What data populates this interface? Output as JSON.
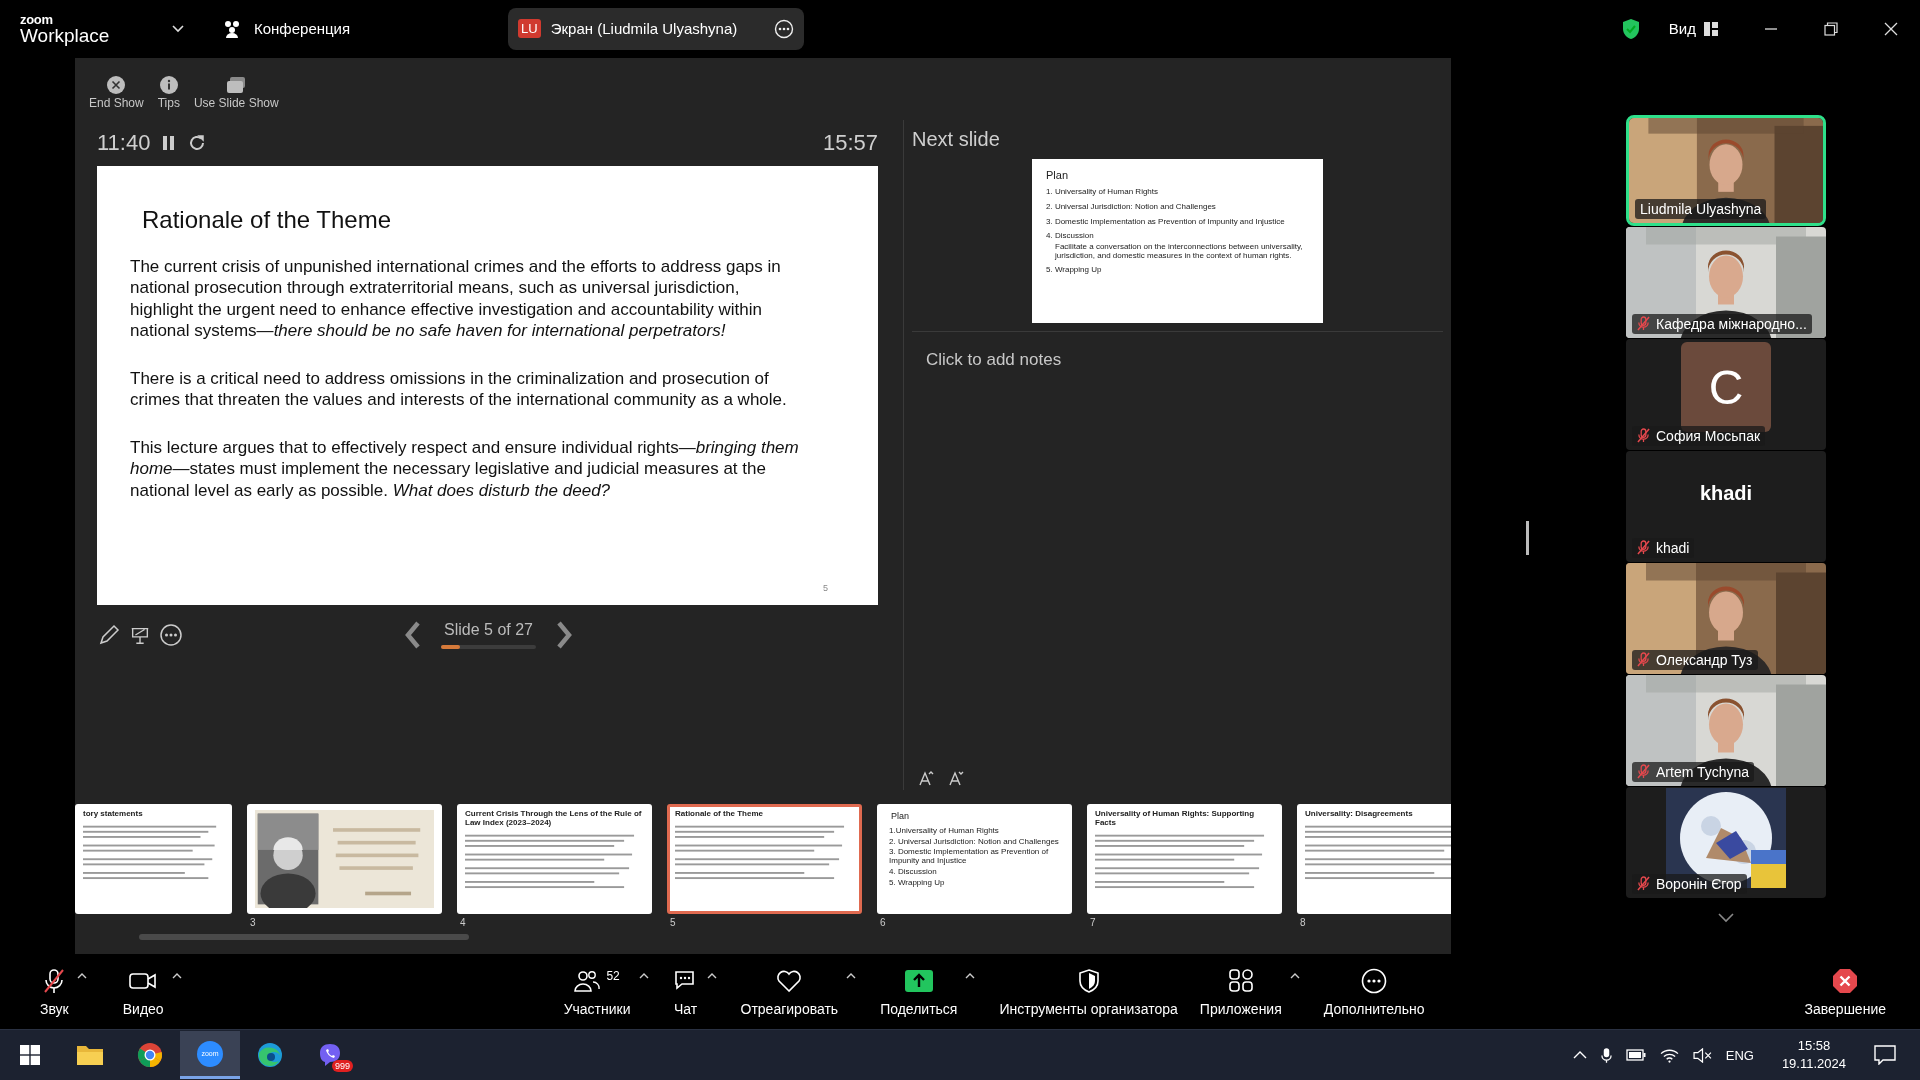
{
  "title_bar": {
    "logo_top": "zoom",
    "logo_bottom": "Workplace",
    "meeting": "Конференция",
    "share_badge": "LU",
    "share_label": "Экран (Liudmila Ulyashyna)",
    "view": "Вид"
  },
  "presenter": {
    "toolbar": [
      {
        "label": "End Show",
        "kind": "end"
      },
      {
        "label": "Tips",
        "kind": "tips"
      },
      {
        "label": "Use Slide Show",
        "kind": "slideshow"
      }
    ],
    "elapsed": "11:40",
    "clock": "15:57",
    "slide": {
      "title": "Rationale of the Theme",
      "paragraphs": [
        "The current crisis of unpunished international crimes and the efforts to address gaps in national prosecution through extraterritorial means, such as universal jurisdiction, highlight the urgent need to enhance effective investigation and accountability within national systems—*there should be no safe haven for international perpetrators!*",
        "There is a critical need to address omissions in the criminalization and prosecution of crimes that threaten the values and interests of the international community as a whole.",
        "This lecture argues that to effectively respect and ensure individual rights—*bringing them home*—states must implement the necessary legislative and judicial measures at the national level as early as possible. *What does disturb the deed?*"
      ],
      "page_number": "5"
    },
    "counter": "Slide 5 of 27",
    "progress": {
      "level": 0.2
    },
    "next_label": "Next slide",
    "next_slide": {
      "title": "Plan",
      "items": [
        {
          "text": "1. Universality of Human Rights"
        },
        {
          "text": "2. Universal Jurisdiction: Notion and Challenges"
        },
        {
          "text": "3. Domestic Implementation as Prevention of Impunity and Injustice"
        },
        {
          "text": "4. Discussion",
          "note": "Facilitate a conversation on the interconnections between universality, jurisdiction, and domestic measures in the context of human rights."
        },
        {
          "text": "5. Wrapping Up"
        }
      ]
    },
    "notes_placeholder": "Click to add notes"
  },
  "thumbnails": [
    {
      "kind": "text",
      "title": "tory statements",
      "partial": true,
      "selected": false
    },
    {
      "kind": "picture",
      "number": "3",
      "selected": false
    },
    {
      "kind": "text",
      "number": "4",
      "title": "Current Crisis Through the Lens of the Rule of Law Index (2023–2024)",
      "selected": false
    },
    {
      "kind": "text",
      "number": "5",
      "title": "Rationale of the Theme",
      "selected": true
    },
    {
      "kind": "plan",
      "number": "6",
      "title": "Plan",
      "items": [
        "1.Universality of Human Rights",
        "2. Universal Jurisdiction: Notion and Challenges",
        "3. Domestic Implementation as Prevention of Impunity and Injustice",
        "4. Discussion",
        "5. Wrapping Up"
      ],
      "selected": false
    },
    {
      "kind": "text",
      "number": "7",
      "title": "Universality of Human Rights: Supporting Facts",
      "selected": false
    },
    {
      "kind": "text",
      "number": "8",
      "title": "Universality: Disagreements",
      "selected": false
    }
  ],
  "participants": [
    {
      "kind": "video",
      "name": "Liudmila Ulyashyna",
      "muted": false,
      "speaking": true
    },
    {
      "kind": "video",
      "name": "Кафедра міжнародно...",
      "muted": true,
      "speaking": false
    },
    {
      "kind": "initial",
      "initial": "C",
      "name": "София Мосьпак",
      "muted": true,
      "speaking": false
    },
    {
      "kind": "name",
      "display_name": "khadi",
      "name": "khadi",
      "muted": true,
      "speaking": false
    },
    {
      "kind": "video",
      "name": "Олександр Туз",
      "muted": true,
      "speaking": false
    },
    {
      "kind": "video",
      "name": "Artem Tychyna",
      "muted": true,
      "speaking": false
    },
    {
      "name": "Воронін Єгор",
      "muted": true,
      "speaking": false
    }
  ],
  "toolbar": [
    {
      "kind": "audio",
      "label": "Звук",
      "muted": true
    },
    {
      "kind": "video",
      "label": "Видео"
    },
    {
      "kind": "participants",
      "label": "Участники",
      "count": "52"
    },
    {
      "kind": "chat",
      "label": "Чат"
    },
    {
      "kind": "react",
      "label": "Отреагировать"
    },
    {
      "kind": "share",
      "label": "Поделиться"
    },
    {
      "kind": "host",
      "label": "Инструменты организатора"
    },
    {
      "kind": "apps",
      "label": "Приложения"
    },
    {
      "kind": "more",
      "label": "Дополнительно"
    },
    {
      "kind": "end",
      "label": "Завершение"
    }
  ],
  "taskbar": {
    "apps": [
      {
        "kind": "explorer",
        "active": false
      },
      {
        "kind": "chrome",
        "active": false
      },
      {
        "kind": "zoom",
        "active": true,
        "label": "zoom"
      },
      {
        "kind": "edge",
        "active": false
      },
      {
        "kind": "viber",
        "active": false,
        "badge": "999"
      }
    ],
    "language": "ENG",
    "time": "15:58",
    "date": "19.11.2024"
  }
}
